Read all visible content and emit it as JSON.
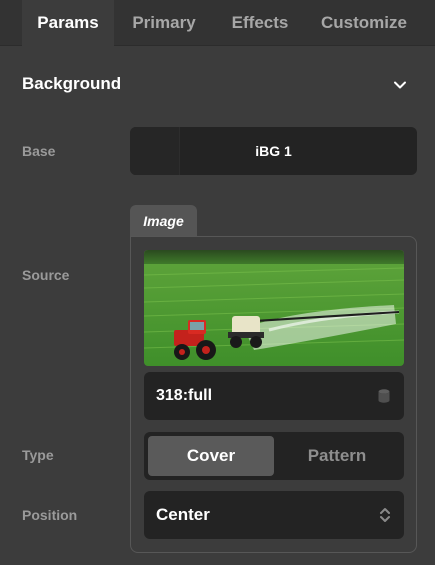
{
  "tabs": [
    {
      "label": "Params",
      "active": true
    },
    {
      "label": "Primary",
      "active": false
    },
    {
      "label": "Effects",
      "active": false
    },
    {
      "label": "Customize",
      "active": false
    }
  ],
  "section": {
    "title": "Background",
    "chevron_icon": "chevron-down-icon"
  },
  "base": {
    "label": "Base",
    "value": "iBG 1"
  },
  "source": {
    "label": "Source",
    "tag": "Image",
    "thumbnail_icon": "image-thumbnail-tractor-field",
    "file_value": "318:full",
    "file_icon": "database-icon"
  },
  "type": {
    "label": "Type",
    "options": [
      "Cover",
      "Pattern"
    ],
    "selected": "Cover"
  },
  "position": {
    "label": "Position",
    "value": "Center",
    "icon": "up-down-arrows-icon"
  },
  "colors": {
    "background": "#3c3c3c",
    "tabbar": "#333333",
    "field": "#232323",
    "active_segment": "#5a5a5a"
  }
}
